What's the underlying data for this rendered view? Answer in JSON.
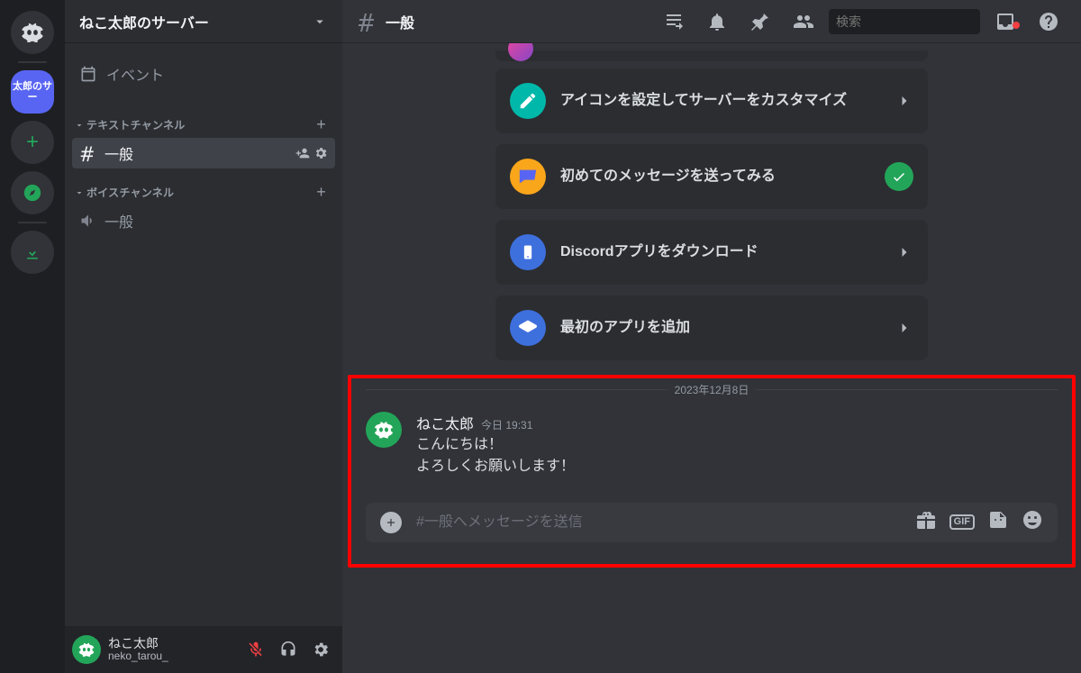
{
  "guilds": {
    "selected_label": "太郎のサー"
  },
  "server": {
    "name": "ねこ太郎のサーバー",
    "events_label": "イベント",
    "text_category": "テキストチャンネル",
    "voice_category": "ボイスチャンネル",
    "text_channels": [
      {
        "name": "一般",
        "active": true
      }
    ],
    "voice_channels": [
      {
        "name": "一般"
      }
    ]
  },
  "user_panel": {
    "display_name": "ねこ太郎",
    "username": "neko_tarou_"
  },
  "header": {
    "channel_name": "一般",
    "search_placeholder": "検索"
  },
  "onboarding": {
    "cards": [
      {
        "text": "アイコンを設定してサーバーをカスタマイズ",
        "icon_bg": "#3ba55c",
        "done": false
      },
      {
        "text": "初めてのメッセージを送ってみる",
        "icon_bg": "#faa61a",
        "done": true
      },
      {
        "text": "Discordアプリをダウンロード",
        "icon_bg": "#3e70dd",
        "done": false
      },
      {
        "text": "最初のアプリを追加",
        "icon_bg": "#3e70dd",
        "done": false
      }
    ]
  },
  "chat": {
    "date_divider": "2023年12月8日",
    "message": {
      "author": "ねこ太郎",
      "timestamp": "今日 19:31",
      "line1": "こんにちは！",
      "line2": "よろしくお願いします！"
    }
  },
  "composer": {
    "placeholder": "#一般へメッセージを送信"
  }
}
